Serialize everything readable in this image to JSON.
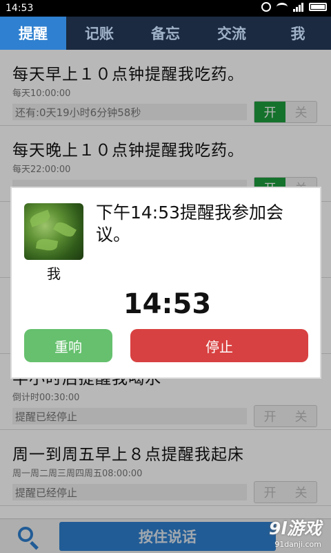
{
  "status_bar": {
    "time": "14:53"
  },
  "tabs": [
    {
      "label": "提醒",
      "active": true
    },
    {
      "label": "记账",
      "active": false
    },
    {
      "label": "备忘",
      "active": false
    },
    {
      "label": "交流",
      "active": false
    },
    {
      "label": "我",
      "active": false
    }
  ],
  "reminders": [
    {
      "title": "每天早上１０点钟提醒我吃药。",
      "schedule": "每天10:00:00",
      "status": "还有:0天19小时6分钟58秒",
      "toggle_on": "开",
      "toggle_off": "关",
      "enabled": true
    },
    {
      "title": "每天晚上１０点钟提醒我吃药。",
      "schedule": "每天22:00:00",
      "status": "",
      "toggle_on": "开",
      "toggle_off": "关",
      "enabled": true
    },
    {
      "title": "半小时后提醒我喝水",
      "schedule": "倒计时00:30:00",
      "status": "提醒已经停止",
      "toggle_on": "开",
      "toggle_off": "关",
      "enabled": false
    },
    {
      "title": "周一到周五早上８点提醒我起床",
      "schedule": "周一周二周三周四周五08:00:00",
      "status": "提醒已经停止",
      "toggle_on": "开",
      "toggle_off": "关",
      "enabled": false
    }
  ],
  "dialog": {
    "avatar_name": "我",
    "message": "下午14:53提醒我参加会议。",
    "time": "14:53",
    "repeat_label": "重响",
    "stop_label": "停止"
  },
  "bottom_bar": {
    "talk_label": "按住说话"
  },
  "watermark": {
    "main": "9l游戏",
    "sub": "91danji.com"
  },
  "colors": {
    "tab_active": "#2f80d0",
    "tab_bar": "#1b2a40",
    "toggle_on": "#1e9e3e",
    "repeat": "#66c06e",
    "stop": "#d84141"
  }
}
